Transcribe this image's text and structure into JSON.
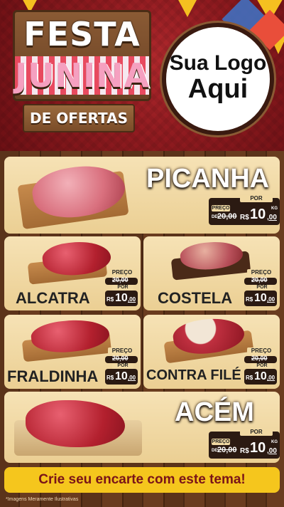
{
  "header": {
    "title_line1": "FESTA",
    "title_line2": "JUNINA",
    "subtitle": "DE OFERTAS",
    "logo_line1": "Sua Logo",
    "logo_line2": "Aqui"
  },
  "products": [
    {
      "name": "PICANHA",
      "preco_label": "PREÇO",
      "por_label": "POR",
      "de_label": "DE",
      "old_price": "20,00",
      "currency": "R$",
      "price_int": "10",
      "price_cents": ",00",
      "unit": "KG"
    },
    {
      "name": "ALCATRA",
      "preco_label": "PREÇO",
      "por_label": "POR",
      "old_price": "20,00",
      "currency": "R$",
      "price_int": "10",
      "price_cents": ",00"
    },
    {
      "name": "COSTELA",
      "preco_label": "PREÇO",
      "por_label": "POR",
      "old_price": "20,00",
      "currency": "R$",
      "price_int": "10",
      "price_cents": ",00"
    },
    {
      "name": "FRALDINHA",
      "preco_label": "PREÇO",
      "por_label": "POR",
      "old_price": "20,00",
      "currency": "R$",
      "price_int": "10",
      "price_cents": ",00"
    },
    {
      "name": "CONTRA FILÉ",
      "preco_label": "PREÇO",
      "por_label": "POR",
      "old_price": "20,00",
      "currency": "R$",
      "price_int": "10",
      "price_cents": ",00"
    },
    {
      "name": "ACÉM",
      "preco_label": "PREÇO",
      "por_label": "POR",
      "de_label": "DE",
      "old_price": "20,00",
      "currency": "R$",
      "price_int": "10",
      "price_cents": ",00",
      "unit": "KG"
    }
  ],
  "cta": "Crie seu encarte com este tema!",
  "footnote": "*Imagens Meramente Ilustrativas"
}
